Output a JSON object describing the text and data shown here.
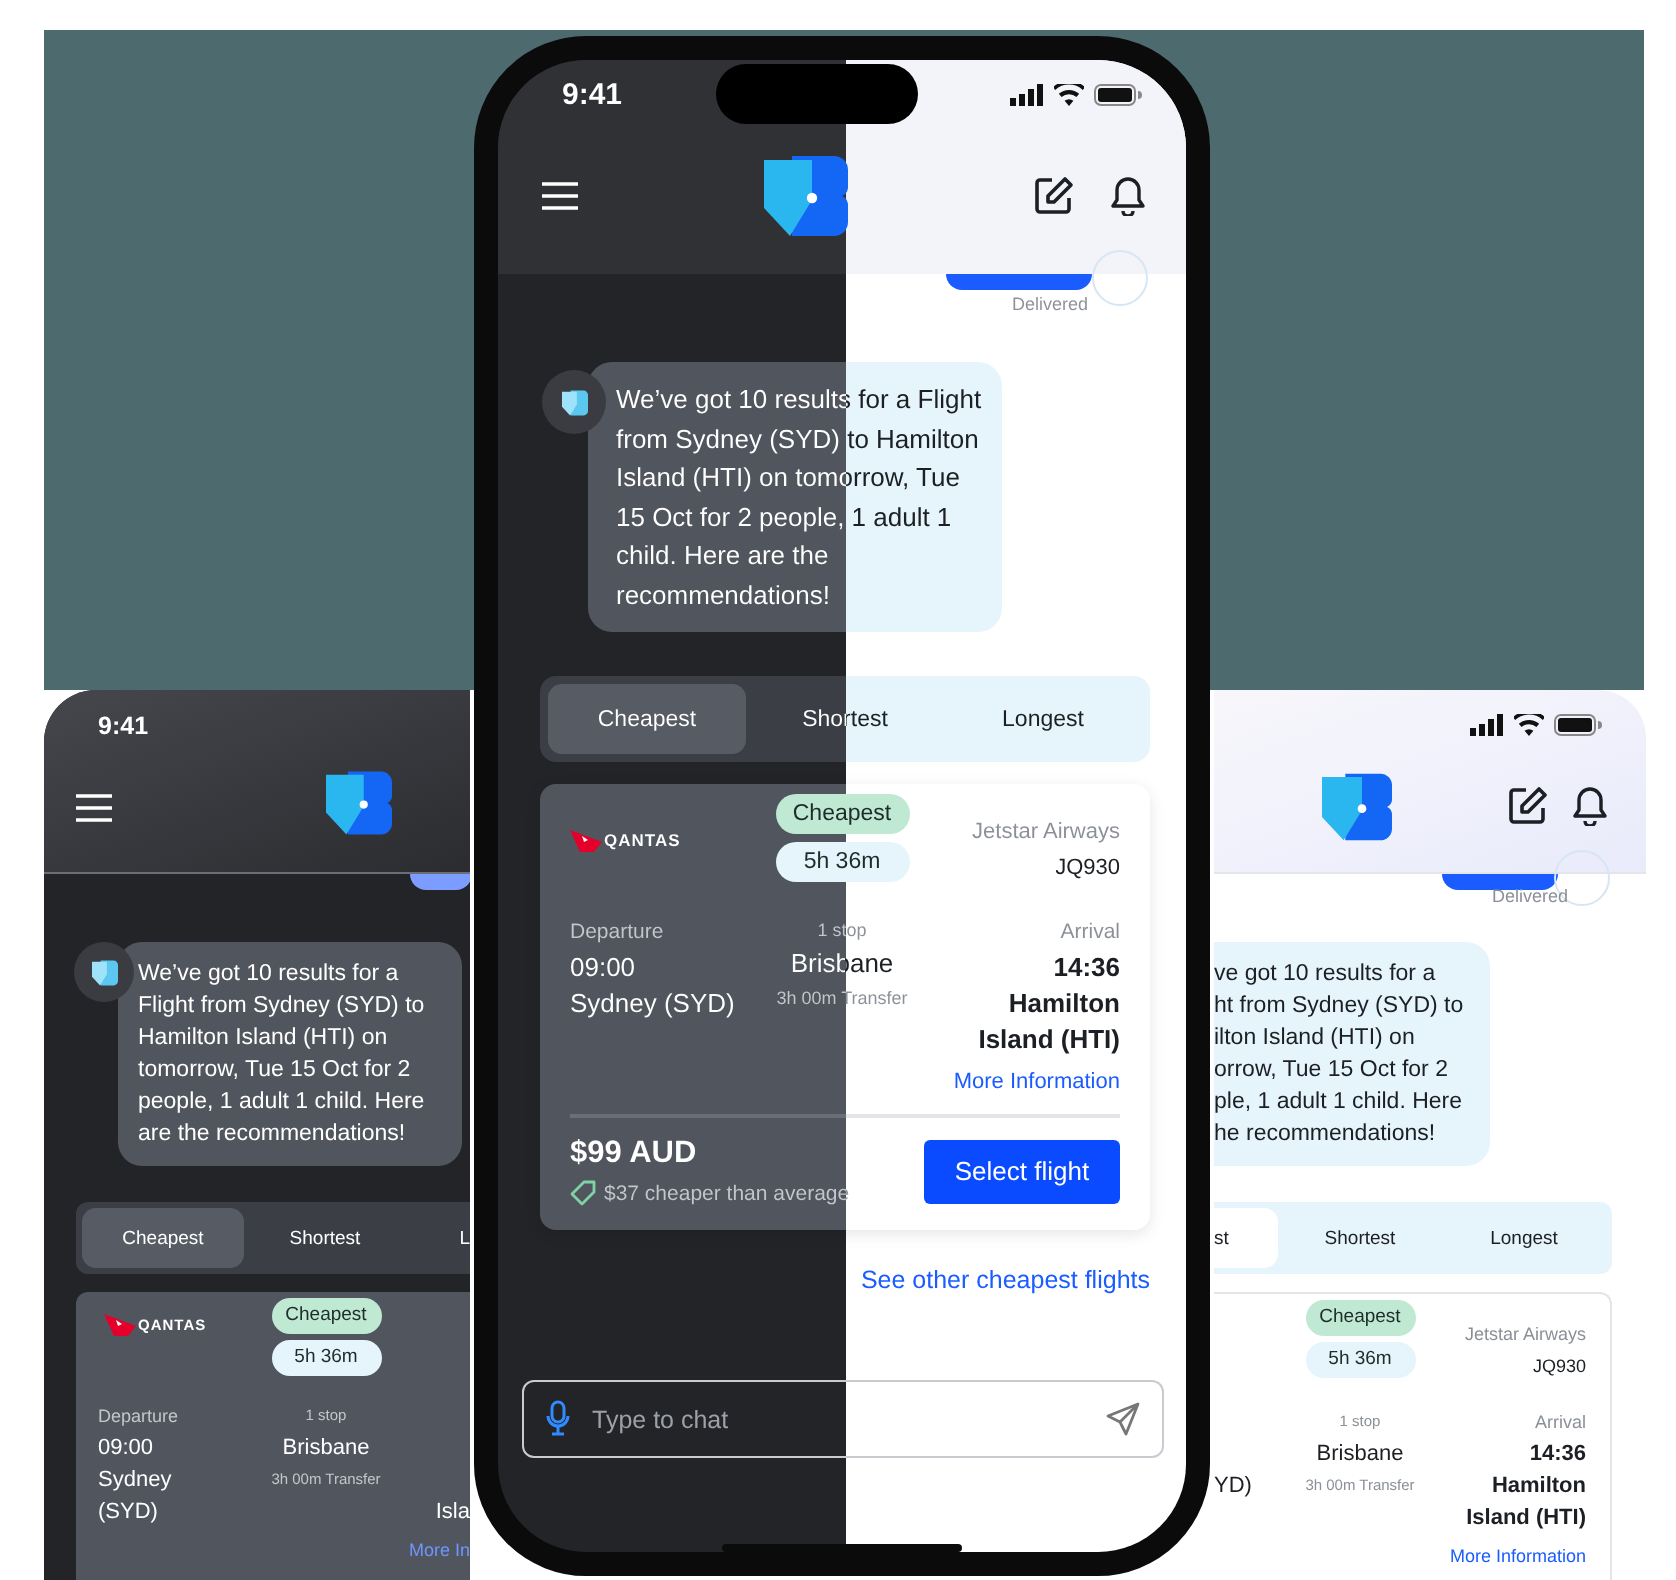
{
  "left_phone": {
    "status_time": "9:41",
    "message": "We’ve got 10 results for a Flight from Sydney (SYD) to Hamilton Island (HTI) on tomorrow, Tue 15 Oct for 2 people, 1 adult 1 child. Here are the recommendations!",
    "tabs": [
      {
        "label": "Cheapest",
        "selected": true
      },
      {
        "label": "Shortest",
        "selected": false
      },
      {
        "label": "L",
        "selected": false
      }
    ],
    "flight": {
      "logo_text": "QANTAS",
      "badges": [
        {
          "label": "Cheapest",
          "color": "#bfe9d3"
        },
        {
          "label": "5h 36m",
          "color": "#e6f5fb"
        }
      ],
      "departure_label": "Departure",
      "departure_time": "09:00",
      "departure_airport": "Sydney (SYD)",
      "stops": "1 stop",
      "via": "Brisbane",
      "transfer": "3h 00m Transfer",
      "arrival_airport": "Isla",
      "more_link": "More In"
    }
  },
  "center_phone": {
    "status_time": "9:41",
    "delivered": "Delivered",
    "message": "We’ve got 10 results for a Flight from Sydney (SYD) to Hamilton Island (HTI) on tomorrow, Tue 15 Oct for 2 people, 1 adult 1 child. Here are the recommendations!",
    "tabs": [
      {
        "label": "Cheapest",
        "selected": true
      },
      {
        "label": "Shortest",
        "selected": false
      },
      {
        "label": "Longest",
        "selected": false
      }
    ],
    "flight": {
      "logo_text": "QANTAS",
      "badges": [
        {
          "label": "Cheapest",
          "color": "#bfe9d3"
        },
        {
          "label": "5h 36m",
          "color": "#e6f5fb"
        }
      ],
      "airline": "Jetstar Airways",
      "flight_number": "JQ930",
      "departure_label": "Departure",
      "departure_time": "09:00",
      "departure_airport": "Sydney (SYD)",
      "stops": "1 stop",
      "via": "Brisbane",
      "transfer": "3h 00m Transfer",
      "arrival_label": "Arrival",
      "arrival_time": "14:36",
      "arrival_airport": "Hamilton Island (HTI)",
      "more_link": "More Information",
      "price": "$99 AUD",
      "saving": "$37 cheaper than average",
      "select_button": "Select flight"
    },
    "see_more_link": "See other cheapest flights",
    "chat_input": {
      "placeholder": "Type to chat"
    }
  },
  "right_phone": {
    "delivered": "Delivered",
    "message": "ve got 10 results for a\nht from Sydney (SYD) to\nilton Island (HTI) on\norrow, Tue 15 Oct for 2\nple, 1 adult 1 child. Here\nhe recommendations!",
    "tabs": [
      {
        "label": "st",
        "selected": true
      },
      {
        "label": "Shortest",
        "selected": false
      },
      {
        "label": "Longest",
        "selected": false
      }
    ],
    "flight": {
      "badges": [
        {
          "label": "Cheapest",
          "color": "#bfe9d3"
        },
        {
          "label": "5h 36m",
          "color": "#e6f5fb"
        }
      ],
      "airline": "Jetstar Airways",
      "flight_number": "JQ930",
      "departure_airport": "YD)",
      "stops": "1 stop",
      "via": "Brisbane",
      "transfer": "3h 00m Transfer",
      "arrival_label": "Arrival",
      "arrival_time": "14:36",
      "arrival_airport": "Hamilton Island (HTI)",
      "more_link": "More Information"
    }
  }
}
